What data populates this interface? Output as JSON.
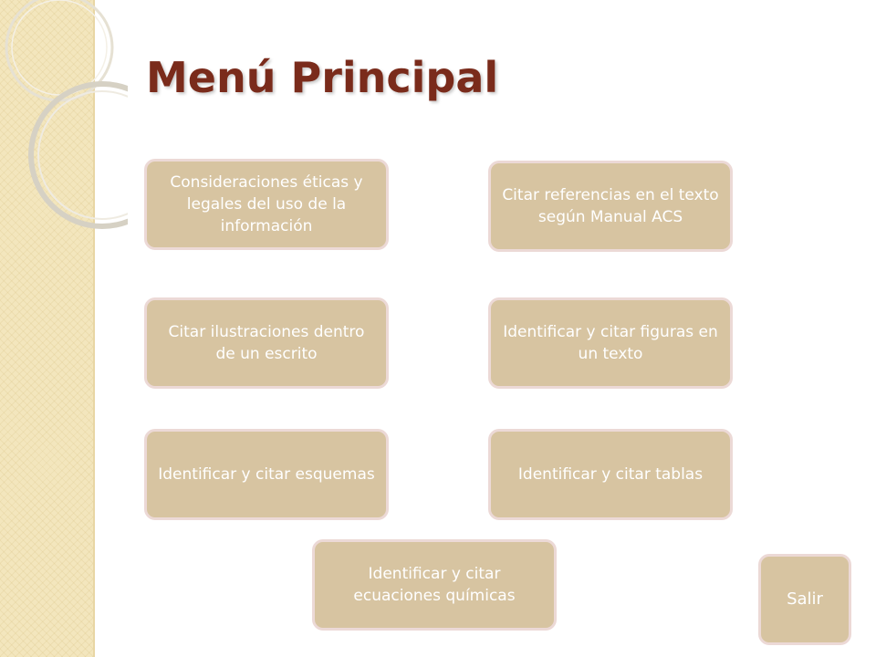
{
  "slide": {
    "title": "Menú Principal"
  },
  "colors": {
    "title": "#7a2b1b",
    "button_fill": "#d7c4a1",
    "button_border": "#ecd9d6",
    "button_text": "#ffffff",
    "side_panel": "#f3e6bd"
  },
  "menu": {
    "eticas": "Consideraciones éticas y legales del uso de la información",
    "acs": "Citar referencias en el texto según Manual ACS",
    "ilustraciones": "Citar ilustraciones dentro de un escrito",
    "figuras": "Identificar y citar figuras en un texto",
    "esquemas": "Identificar y citar esquemas",
    "tablas": "Identificar y citar tablas",
    "ecuaciones": "Identificar y citar ecuaciones químicas",
    "salir": "Salir"
  }
}
